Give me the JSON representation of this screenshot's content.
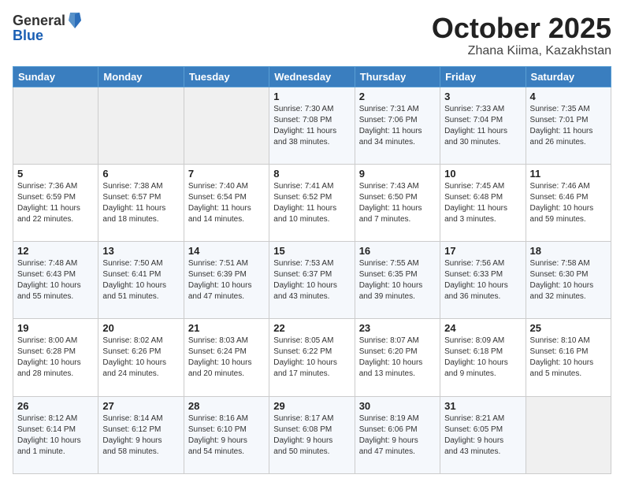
{
  "header": {
    "logo_general": "General",
    "logo_blue": "Blue",
    "month": "October 2025",
    "location": "Zhana Kiima, Kazakhstan"
  },
  "days_of_week": [
    "Sunday",
    "Monday",
    "Tuesday",
    "Wednesday",
    "Thursday",
    "Friday",
    "Saturday"
  ],
  "weeks": [
    [
      {
        "day": "",
        "info": ""
      },
      {
        "day": "",
        "info": ""
      },
      {
        "day": "",
        "info": ""
      },
      {
        "day": "1",
        "info": "Sunrise: 7:30 AM\nSunset: 7:08 PM\nDaylight: 11 hours\nand 38 minutes."
      },
      {
        "day": "2",
        "info": "Sunrise: 7:31 AM\nSunset: 7:06 PM\nDaylight: 11 hours\nand 34 minutes."
      },
      {
        "day": "3",
        "info": "Sunrise: 7:33 AM\nSunset: 7:04 PM\nDaylight: 11 hours\nand 30 minutes."
      },
      {
        "day": "4",
        "info": "Sunrise: 7:35 AM\nSunset: 7:01 PM\nDaylight: 11 hours\nand 26 minutes."
      }
    ],
    [
      {
        "day": "5",
        "info": "Sunrise: 7:36 AM\nSunset: 6:59 PM\nDaylight: 11 hours\nand 22 minutes."
      },
      {
        "day": "6",
        "info": "Sunrise: 7:38 AM\nSunset: 6:57 PM\nDaylight: 11 hours\nand 18 minutes."
      },
      {
        "day": "7",
        "info": "Sunrise: 7:40 AM\nSunset: 6:54 PM\nDaylight: 11 hours\nand 14 minutes."
      },
      {
        "day": "8",
        "info": "Sunrise: 7:41 AM\nSunset: 6:52 PM\nDaylight: 11 hours\nand 10 minutes."
      },
      {
        "day": "9",
        "info": "Sunrise: 7:43 AM\nSunset: 6:50 PM\nDaylight: 11 hours\nand 7 minutes."
      },
      {
        "day": "10",
        "info": "Sunrise: 7:45 AM\nSunset: 6:48 PM\nDaylight: 11 hours\nand 3 minutes."
      },
      {
        "day": "11",
        "info": "Sunrise: 7:46 AM\nSunset: 6:46 PM\nDaylight: 10 hours\nand 59 minutes."
      }
    ],
    [
      {
        "day": "12",
        "info": "Sunrise: 7:48 AM\nSunset: 6:43 PM\nDaylight: 10 hours\nand 55 minutes."
      },
      {
        "day": "13",
        "info": "Sunrise: 7:50 AM\nSunset: 6:41 PM\nDaylight: 10 hours\nand 51 minutes."
      },
      {
        "day": "14",
        "info": "Sunrise: 7:51 AM\nSunset: 6:39 PM\nDaylight: 10 hours\nand 47 minutes."
      },
      {
        "day": "15",
        "info": "Sunrise: 7:53 AM\nSunset: 6:37 PM\nDaylight: 10 hours\nand 43 minutes."
      },
      {
        "day": "16",
        "info": "Sunrise: 7:55 AM\nSunset: 6:35 PM\nDaylight: 10 hours\nand 39 minutes."
      },
      {
        "day": "17",
        "info": "Sunrise: 7:56 AM\nSunset: 6:33 PM\nDaylight: 10 hours\nand 36 minutes."
      },
      {
        "day": "18",
        "info": "Sunrise: 7:58 AM\nSunset: 6:30 PM\nDaylight: 10 hours\nand 32 minutes."
      }
    ],
    [
      {
        "day": "19",
        "info": "Sunrise: 8:00 AM\nSunset: 6:28 PM\nDaylight: 10 hours\nand 28 minutes."
      },
      {
        "day": "20",
        "info": "Sunrise: 8:02 AM\nSunset: 6:26 PM\nDaylight: 10 hours\nand 24 minutes."
      },
      {
        "day": "21",
        "info": "Sunrise: 8:03 AM\nSunset: 6:24 PM\nDaylight: 10 hours\nand 20 minutes."
      },
      {
        "day": "22",
        "info": "Sunrise: 8:05 AM\nSunset: 6:22 PM\nDaylight: 10 hours\nand 17 minutes."
      },
      {
        "day": "23",
        "info": "Sunrise: 8:07 AM\nSunset: 6:20 PM\nDaylight: 10 hours\nand 13 minutes."
      },
      {
        "day": "24",
        "info": "Sunrise: 8:09 AM\nSunset: 6:18 PM\nDaylight: 10 hours\nand 9 minutes."
      },
      {
        "day": "25",
        "info": "Sunrise: 8:10 AM\nSunset: 6:16 PM\nDaylight: 10 hours\nand 5 minutes."
      }
    ],
    [
      {
        "day": "26",
        "info": "Sunrise: 8:12 AM\nSunset: 6:14 PM\nDaylight: 10 hours\nand 1 minute."
      },
      {
        "day": "27",
        "info": "Sunrise: 8:14 AM\nSunset: 6:12 PM\nDaylight: 9 hours\nand 58 minutes."
      },
      {
        "day": "28",
        "info": "Sunrise: 8:16 AM\nSunset: 6:10 PM\nDaylight: 9 hours\nand 54 minutes."
      },
      {
        "day": "29",
        "info": "Sunrise: 8:17 AM\nSunset: 6:08 PM\nDaylight: 9 hours\nand 50 minutes."
      },
      {
        "day": "30",
        "info": "Sunrise: 8:19 AM\nSunset: 6:06 PM\nDaylight: 9 hours\nand 47 minutes."
      },
      {
        "day": "31",
        "info": "Sunrise: 8:21 AM\nSunset: 6:05 PM\nDaylight: 9 hours\nand 43 minutes."
      },
      {
        "day": "",
        "info": ""
      }
    ]
  ]
}
